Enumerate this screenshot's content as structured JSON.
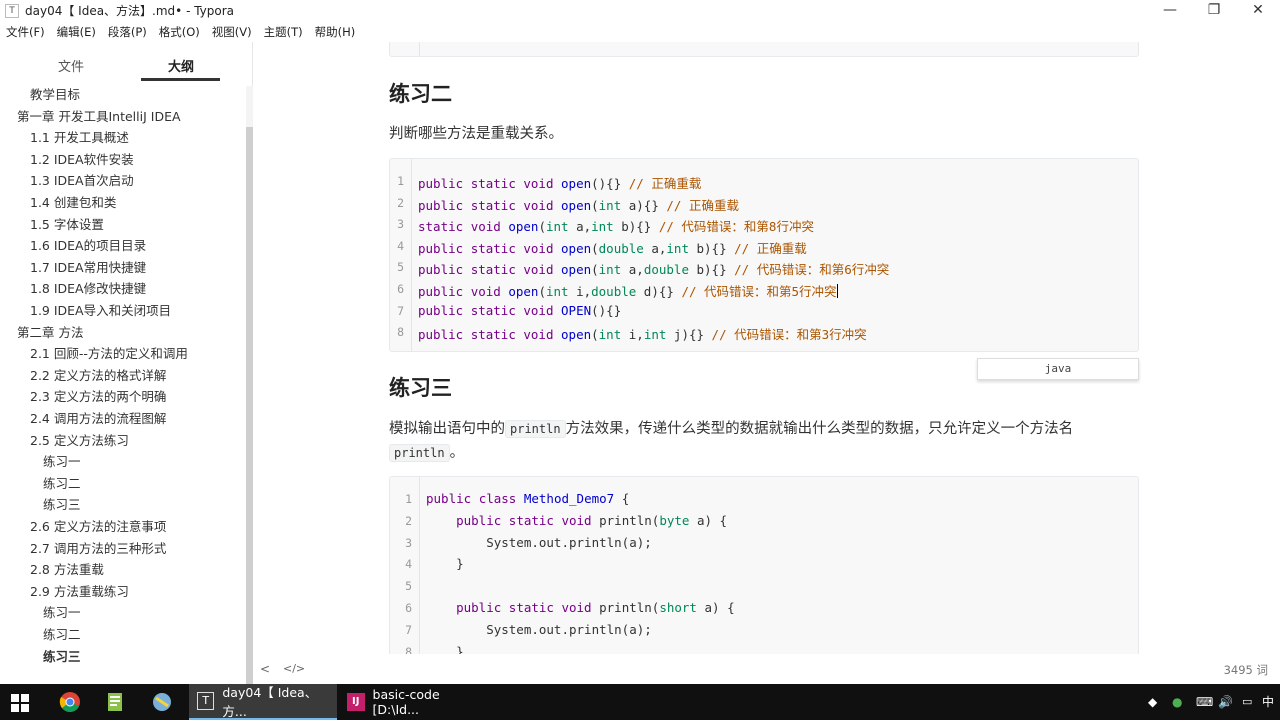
{
  "window": {
    "title": "day04【 Idea、方法】.md• - Typora",
    "minimize": "—",
    "maximize": "❐",
    "close": "✕"
  },
  "menu": [
    "文件(F)",
    "编辑(E)",
    "段落(P)",
    "格式(O)",
    "视图(V)",
    "主题(T)",
    "帮助(H)"
  ],
  "sidebar": {
    "tabs": [
      "文件",
      "大纲"
    ],
    "active_tab": "大纲",
    "items": [
      {
        "label": "教学目标",
        "level": 2
      },
      {
        "label": "第一章 开发工具IntelliJ IDEA",
        "level": 1
      },
      {
        "label": "1.1 开发工具概述",
        "level": 2
      },
      {
        "label": "1.2 IDEA软件安装",
        "level": 2
      },
      {
        "label": "1.3 IDEA首次启动",
        "level": 2
      },
      {
        "label": "1.4 创建包和类",
        "level": 2
      },
      {
        "label": "1.5 字体设置",
        "level": 2
      },
      {
        "label": "1.6 IDEA的项目目录",
        "level": 2
      },
      {
        "label": "1.7 IDEA常用快捷键",
        "level": 2
      },
      {
        "label": "1.8 IDEA修改快捷键",
        "level": 2
      },
      {
        "label": "1.9 IDEA导入和关闭项目",
        "level": 2
      },
      {
        "label": "第二章 方法",
        "level": 1
      },
      {
        "label": "2.1 回顾--方法的定义和调用",
        "level": 2
      },
      {
        "label": "2.2 定义方法的格式详解",
        "level": 2
      },
      {
        "label": "2.3 定义方法的两个明确",
        "level": 2
      },
      {
        "label": "2.4 调用方法的流程图解",
        "level": 2
      },
      {
        "label": "2.5 定义方法练习",
        "level": 2
      },
      {
        "label": "练习一",
        "level": 3
      },
      {
        "label": "练习二",
        "level": 3
      },
      {
        "label": "练习三",
        "level": 3
      },
      {
        "label": "2.6 定义方法的注意事项",
        "level": 2
      },
      {
        "label": "2.7 调用方法的三种形式",
        "level": 2
      },
      {
        "label": "2.8 方法重载",
        "level": 2
      },
      {
        "label": "2.9 方法重载练习",
        "level": 2
      },
      {
        "label": "练习一",
        "level": 3
      },
      {
        "label": "练习二",
        "level": 3
      },
      {
        "label": "练习三",
        "level": 3,
        "active": true
      }
    ]
  },
  "content": {
    "heading2": "练习二",
    "para2": "判断哪些方法是重载关系。",
    "code2": {
      "lines": [
        "public static void open(){} // 正确重载",
        "public static void open(int a){} // 正确重载",
        "static void open(int a,int b){} // 代码错误：和第8行冲突",
        "public static void open(double a,int b){} // 正确重载",
        "public static void open(int a,double b){} // 代码错误：和第6行冲突",
        "public void open(int i,double d){} // 代码错误：和第5行冲突",
        "public static void OPEN(){}",
        "public static void open(int i,int j){} // 代码错误：和第3行冲突"
      ],
      "language": "java"
    },
    "heading3": "练习三",
    "para3_before": "模拟输出语句中的",
    "para3_code": "println",
    "para3_after": "方法效果，传递什么类型的数据就输出什么类型的数据，只允许定义一个方法名",
    "para3_code2": "println",
    "para3_end": "。",
    "code3": {
      "lines": [
        "public class Method_Demo7 {",
        "    public static void println(byte a) {",
        "        System.out.println(a);",
        "    }",
        "",
        "    public static void println(short a) {",
        "        System.out.println(a);",
        "    }"
      ]
    }
  },
  "footer": {
    "back_icon": "<",
    "source_icon": "</>",
    "word_count": "3495 词"
  },
  "taskbar": {
    "apps": [
      {
        "label": "day04【 Idea、方...",
        "icon": "typora-icon",
        "active": true
      },
      {
        "label": "basic-code [D:\\Id...",
        "icon": "intellij-icon",
        "active": false
      }
    ],
    "ime": "中"
  }
}
